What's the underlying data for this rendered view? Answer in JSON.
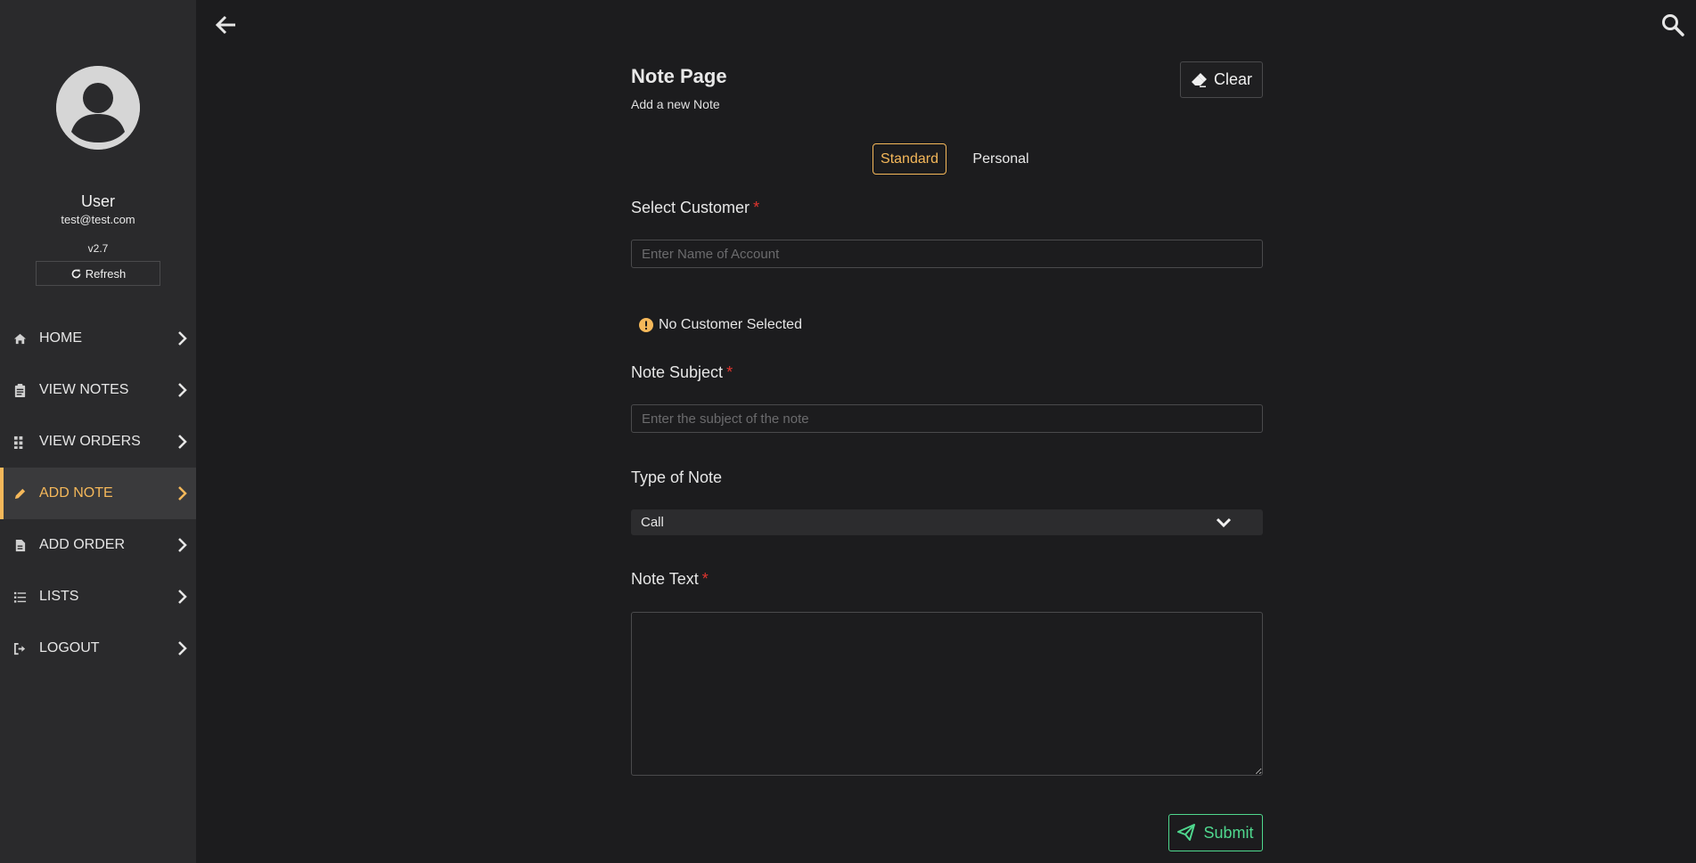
{
  "sidebar": {
    "user_name": "User",
    "user_email": "test@test.com",
    "version": "v2.7",
    "refresh_label": "Refresh",
    "items": [
      {
        "label": "HOME",
        "icon": "home-icon"
      },
      {
        "label": "VIEW NOTES",
        "icon": "clipboard-icon"
      },
      {
        "label": "VIEW ORDERS",
        "icon": "grid-icon"
      },
      {
        "label": "ADD NOTE",
        "icon": "pencil-icon",
        "active": true
      },
      {
        "label": "ADD ORDER",
        "icon": "invoice-icon"
      },
      {
        "label": "LISTS",
        "icon": "list-icon"
      },
      {
        "label": "LOGOUT",
        "icon": "logout-icon"
      }
    ]
  },
  "header": {
    "back_icon": "arrow-left-icon",
    "search_icon": "search-icon"
  },
  "form": {
    "title": "Note Page",
    "subtitle": "Add a new Note",
    "clear_label": "Clear",
    "tabs": [
      {
        "label": "Standard",
        "active": true
      },
      {
        "label": "Personal",
        "active": false
      }
    ],
    "customer": {
      "label": "Select Customer",
      "required_mark": "*",
      "placeholder": "Enter Name of Account",
      "value": "",
      "status": "No Customer Selected"
    },
    "subject": {
      "label": "Note Subject",
      "required_mark": "*",
      "placeholder": "Enter the subject of the note",
      "value": ""
    },
    "type": {
      "label": "Type of Note",
      "selected": "Call"
    },
    "text": {
      "label": "Note Text",
      "required_mark": "*",
      "value": ""
    },
    "submit_label": "Submit"
  },
  "colors": {
    "accent": "#f5b85a",
    "success": "#4fd88e",
    "required": "#e0352f",
    "background": "#1c1c1e",
    "sidebar": "#2a2a2c"
  }
}
